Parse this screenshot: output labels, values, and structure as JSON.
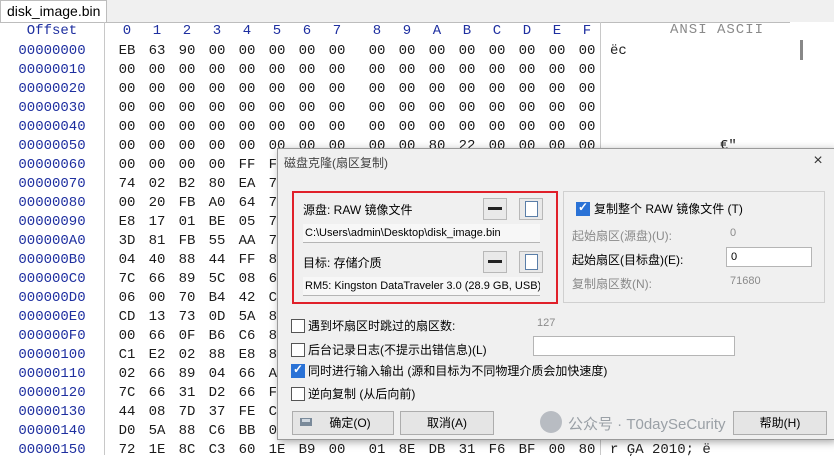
{
  "tab": {
    "title": "disk_image.bin"
  },
  "hex": {
    "header": {
      "offset": "Offset",
      "cols": [
        "0",
        "1",
        "2",
        "3",
        "4",
        "5",
        "6",
        "7",
        "8",
        "9",
        "A",
        "B",
        "C",
        "D",
        "E",
        "F"
      ],
      "ascii": "ANSI ASCII"
    },
    "rows": [
      {
        "offset": "00000000",
        "bytes": [
          "EB",
          "63",
          "90",
          "00",
          "00",
          "00",
          "00",
          "00",
          "00",
          "00",
          "00",
          "00",
          "00",
          "00",
          "00",
          "00"
        ],
        "ascii": "ëc"
      },
      {
        "offset": "00000010",
        "bytes": [
          "00",
          "00",
          "00",
          "00",
          "00",
          "00",
          "00",
          "00",
          "00",
          "00",
          "00",
          "00",
          "00",
          "00",
          "00",
          "00"
        ],
        "ascii": ""
      },
      {
        "offset": "00000020",
        "bytes": [
          "00",
          "00",
          "00",
          "00",
          "00",
          "00",
          "00",
          "00",
          "00",
          "00",
          "00",
          "00",
          "00",
          "00",
          "00",
          "00"
        ],
        "ascii": ""
      },
      {
        "offset": "00000030",
        "bytes": [
          "00",
          "00",
          "00",
          "00",
          "00",
          "00",
          "00",
          "00",
          "00",
          "00",
          "00",
          "00",
          "00",
          "00",
          "00",
          "00"
        ],
        "ascii": ""
      },
      {
        "offset": "00000040",
        "bytes": [
          "00",
          "00",
          "00",
          "00",
          "00",
          "00",
          "00",
          "00",
          "00",
          "00",
          "00",
          "00",
          "00",
          "00",
          "00",
          "00"
        ],
        "ascii": ""
      },
      {
        "offset": "00000050",
        "bytes": [
          "00",
          "00",
          "00",
          "00",
          "00",
          "00",
          "00",
          "00",
          "00",
          "00",
          "80",
          "22",
          "00",
          "00",
          "00",
          "00"
        ],
        "ascii": "€\""
      },
      {
        "offset": "00000060",
        "bytes": [
          "00",
          "00",
          "00",
          "00",
          "FF",
          "FA",
          "",
          "",
          "",
          "",
          "",
          "",
          "",
          "",
          "",
          ""
        ],
        "ascii": ""
      },
      {
        "offset": "00000070",
        "bytes": [
          "74",
          "02",
          "B2",
          "80",
          "EA",
          "79",
          "",
          "",
          "",
          "",
          "",
          "",
          "",
          "",
          "",
          ""
        ],
        "ascii": ""
      },
      {
        "offset": "00000080",
        "bytes": [
          "00",
          "20",
          "FB",
          "A0",
          "64",
          "7C",
          "",
          "",
          "",
          "",
          "",
          "",
          "",
          "",
          "",
          ""
        ],
        "ascii": ""
      },
      {
        "offset": "00000090",
        "bytes": [
          "E8",
          "17",
          "01",
          "BE",
          "05",
          "7C",
          "",
          "",
          "",
          "",
          "",
          "",
          "",
          "",
          "",
          ""
        ],
        "ascii": ""
      },
      {
        "offset": "000000A0",
        "bytes": [
          "3D",
          "81",
          "FB",
          "55",
          "AA",
          "75",
          "",
          "",
          "",
          "",
          "",
          "",
          "",
          "",
          "",
          ""
        ],
        "ascii": ""
      },
      {
        "offset": "000000B0",
        "bytes": [
          "04",
          "40",
          "88",
          "44",
          "FF",
          "89",
          "",
          "",
          "",
          "",
          "",
          "",
          "",
          "",
          "",
          ""
        ],
        "ascii": ""
      },
      {
        "offset": "000000C0",
        "bytes": [
          "7C",
          "66",
          "89",
          "5C",
          "08",
          "66",
          "",
          "",
          "",
          "",
          "",
          "",
          "",
          "",
          "",
          ""
        ],
        "ascii": ""
      },
      {
        "offset": "000000D0",
        "bytes": [
          "06",
          "00",
          "70",
          "B4",
          "42",
          "CD",
          "",
          "",
          "",
          "",
          "",
          "",
          "",
          "",
          "",
          ""
        ],
        "ascii": ""
      },
      {
        "offset": "000000E0",
        "bytes": [
          "CD",
          "13",
          "73",
          "0D",
          "5A",
          "84",
          "",
          "",
          "",
          "",
          "",
          "",
          "",
          "",
          "",
          ""
        ],
        "ascii": ""
      },
      {
        "offset": "000000F0",
        "bytes": [
          "00",
          "66",
          "0F",
          "B6",
          "C6",
          "88",
          "",
          "",
          "",
          "",
          "",
          "",
          "",
          "",
          "",
          ""
        ],
        "ascii": ""
      },
      {
        "offset": "00000100",
        "bytes": [
          "C1",
          "E2",
          "02",
          "88",
          "E8",
          "88",
          "",
          "",
          "",
          "",
          "",
          "",
          "",
          "",
          "",
          ""
        ],
        "ascii": ""
      },
      {
        "offset": "00000110",
        "bytes": [
          "02",
          "66",
          "89",
          "04",
          "66",
          "A1",
          "",
          "",
          "",
          "",
          "",
          "",
          "",
          "",
          "",
          ""
        ],
        "ascii": ""
      },
      {
        "offset": "00000120",
        "bytes": [
          "7C",
          "66",
          "31",
          "D2",
          "66",
          "F7",
          "",
          "",
          "",
          "",
          "",
          "",
          "",
          "",
          "",
          ""
        ],
        "ascii": ""
      },
      {
        "offset": "00000130",
        "bytes": [
          "44",
          "08",
          "7D",
          "37",
          "FE",
          "C1",
          "",
          "",
          "",
          "",
          "",
          "",
          "",
          "",
          "",
          ""
        ],
        "ascii": ""
      },
      {
        "offset": "00000140",
        "bytes": [
          "D0",
          "5A",
          "88",
          "C6",
          "BB",
          "00",
          "",
          "",
          "",
          "",
          "",
          "",
          "",
          "",
          "",
          ""
        ],
        "ascii": ""
      },
      {
        "offset": "00000150",
        "bytes": [
          "72",
          "1E",
          "8C",
          "C3",
          "60",
          "1E",
          "B9",
          "00",
          "01",
          "8E",
          "DB",
          "31",
          "F6",
          "BF",
          "00",
          "80"
        ],
        "ascii": "r ĢA   2010; ë"
      }
    ]
  },
  "dialog": {
    "title": "磁盘克隆(扇区复制)",
    "close": "×",
    "source": {
      "label": "源盘: RAW 镜像文件",
      "path": "C:\\Users\\admin\\Desktop\\disk_image.bin"
    },
    "target": {
      "label": "目标: 存储介质",
      "path": "RM5: Kingston DataTraveler 3.0 (28.9 GB, USB)"
    },
    "copy_entire": {
      "label": "复制整个 RAW 镜像文件 (T)",
      "checked": true
    },
    "start_src": {
      "label": "起始扇区(源盘)(U):",
      "value": "0"
    },
    "start_dst": {
      "label": "起始扇区(目标盘)(E):",
      "value": "0"
    },
    "count": {
      "label": "复制扇区数(N):",
      "value": "71680"
    },
    "skip_bad": {
      "label": "遇到坏扇区时跳过的扇区数:",
      "value": "127",
      "checked": false
    },
    "log": {
      "label": "后台记录日志(不提示出错信息)(L)",
      "checked": false
    },
    "simultaneous": {
      "label": "同时进行输入输出 (源和目标为不同物理介质会加快速度)",
      "checked": true
    },
    "reverse": {
      "label": "逆向复制 (从后向前)",
      "checked": false
    },
    "ok": "确定(O)",
    "cancel": "取消(A)",
    "help": "帮助(H)"
  },
  "watermark": "公众号 · T0daySeCurity"
}
